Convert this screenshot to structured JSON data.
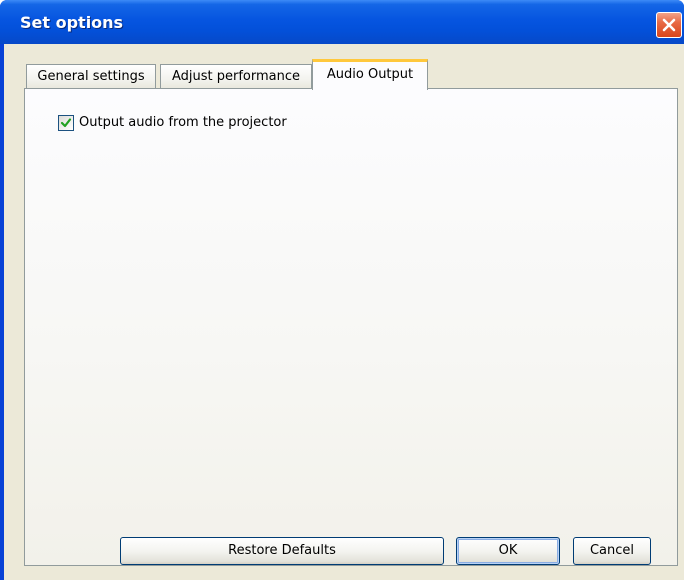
{
  "window": {
    "title": "Set options"
  },
  "tabs": [
    {
      "label": "General settings",
      "active": false
    },
    {
      "label": "Adjust performance",
      "active": false
    },
    {
      "label": "Audio Output",
      "active": true
    }
  ],
  "audio_output": {
    "checkbox_label": "Output audio from the projector",
    "checked": true
  },
  "buttons": {
    "restore_defaults": "Restore Defaults",
    "ok": "OK",
    "cancel": "Cancel"
  },
  "icons": {
    "close": "close-icon",
    "checkmark": "checkmark-icon"
  },
  "colors": {
    "titlebar": "#0655e0",
    "close_button": "#d8451c",
    "active_tab_accent": "#ffc83c",
    "dialog_background": "#ece9d8",
    "checkmark": "#21a121"
  }
}
